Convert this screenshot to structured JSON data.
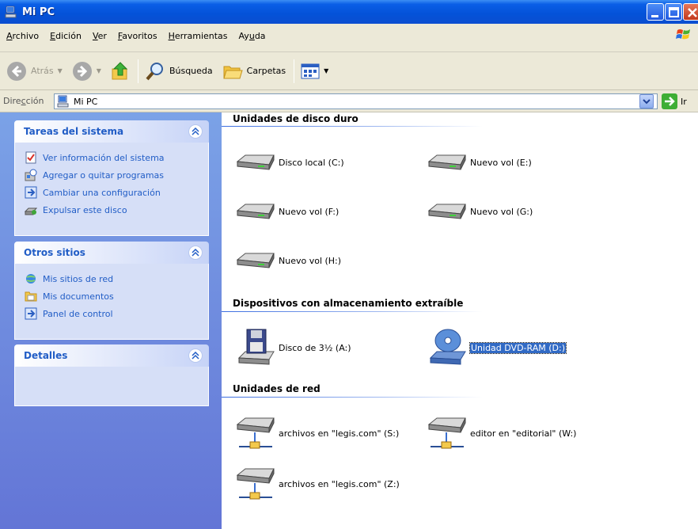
{
  "window": {
    "title": "Mi PC"
  },
  "menu": {
    "items": [
      {
        "mn": "A",
        "rest": "rchivo"
      },
      {
        "mn": "E",
        "rest": "dición"
      },
      {
        "mn": "V",
        "rest": "er"
      },
      {
        "mn": "F",
        "rest": "avoritos"
      },
      {
        "mn": "H",
        "rest": "erramientas"
      },
      {
        "pre": "Ay",
        "mn": "u",
        "rest": "da"
      }
    ]
  },
  "toolbar": {
    "back_label": "Atrás",
    "search_label": "Búsqueda",
    "folders_label": "Carpetas"
  },
  "address": {
    "label_pre": "Dire",
    "label_mn": "c",
    "label_rest": "ción",
    "value": "Mi PC",
    "go_label": "Ir"
  },
  "taskpane": {
    "system_tasks": {
      "title": "Tareas del sistema",
      "items": [
        {
          "label": "Ver información del sistema",
          "icon": "system-info-icon"
        },
        {
          "label": "Agregar o quitar programas",
          "icon": "add-remove-programs-icon"
        },
        {
          "label": "Cambiar una configuración",
          "icon": "change-setting-icon"
        },
        {
          "label": "Expulsar este disco",
          "icon": "eject-disk-icon"
        }
      ]
    },
    "other_places": {
      "title": "Otros sitios",
      "items": [
        {
          "label": "Mis sitios de red",
          "icon": "network-places-icon"
        },
        {
          "label": "Mis documentos",
          "icon": "my-documents-icon"
        },
        {
          "label": "Panel de control",
          "icon": "control-panel-icon"
        }
      ]
    },
    "details": {
      "title": "Detalles"
    }
  },
  "content": {
    "hard_drives": {
      "title": "Unidades de disco duro",
      "items": [
        "Disco local (C:)",
        "Nuevo vol (E:)",
        "Nuevo vol (F:)",
        "Nuevo vol (G:)",
        "Nuevo vol (H:)"
      ]
    },
    "removable": {
      "title": "Dispositivos con almacenamiento extraíble",
      "items": [
        "Disco de 3½ (A:)",
        "Unidad DVD-RAM (D:)"
      ]
    },
    "network": {
      "title": "Unidades de red",
      "items": [
        "archivos en \"legis.com\" (S:)",
        "editor en \"editorial\" (W:)",
        "archivos en \"legis.com\" (Z:)"
      ]
    }
  },
  "colors": {
    "titlebar": "#0452d8",
    "taskpane": "#6f8fde",
    "link": "#215dc6",
    "selection": "#316ac5"
  }
}
